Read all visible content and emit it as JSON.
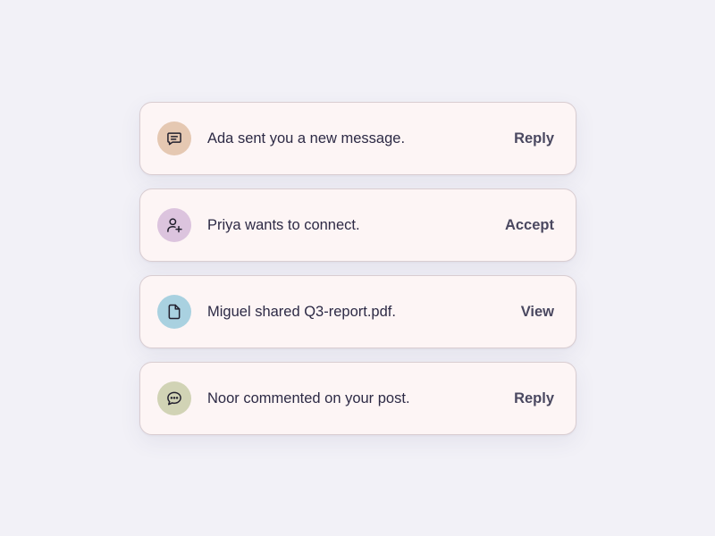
{
  "notifications": [
    {
      "icon": "message-square-icon",
      "icon_bg": "#e5c8b2",
      "text": "Ada sent you a new message.",
      "action": "Reply"
    },
    {
      "icon": "user-plus-icon",
      "icon_bg": "#dcc4de",
      "text": "Priya wants to connect.",
      "action": "Accept"
    },
    {
      "icon": "file-icon",
      "icon_bg": "#a9d1e0",
      "text": "Miguel shared Q3-report.pdf.",
      "action": "View"
    },
    {
      "icon": "comment-dots-icon",
      "icon_bg": "#d1d3b5",
      "text": "Noor commented on your post.",
      "action": "Reply"
    }
  ]
}
